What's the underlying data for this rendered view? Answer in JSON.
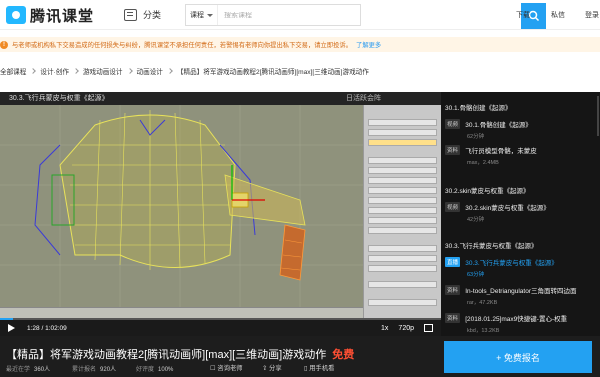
{
  "header": {
    "brand": "腾讯课堂",
    "category_label": "分类",
    "search_type": "课程",
    "search_placeholder": "搜索课程",
    "links": [
      "下载",
      "私信",
      "登录"
    ]
  },
  "notice": {
    "text": "与老师或机构私下交易造成的任何损失与纠纷，腾讯课堂不承担任何责任，若警惕有老师向你提出私下交易，请立即投诉。",
    "link": "了解更多"
  },
  "breadcrumb": [
    "全部课程",
    "设计·创作",
    "游戏动画设计",
    "动画设计",
    "【精品】将军游戏动画教程2[腾讯动画师][max][三维动画]游戏动作"
  ],
  "player": {
    "title": "30.3.飞行兵蒙皮与权重《起源》",
    "app_title": "日活跃会阵",
    "time": "1:28 / 1:02:09",
    "quality": "720p",
    "speed": "1x",
    "progress": 0.03
  },
  "playlist": {
    "sections": [
      "30.1.骨骼创建《起源》",
      "30.2.skin蒙皮与权重《起源》",
      "30.3.飞行兵蒙皮与权重《起源》"
    ],
    "items": [
      {
        "tag": "视频",
        "title": "30.1.骨骼创建《起源》",
        "sub": "62分钟"
      },
      {
        "tag": "资料",
        "title": "飞行员模型骨骼，未蒙皮",
        "sub": "max，2.4MB"
      },
      {
        "tag": "视频",
        "title": "30.2.skin蒙皮与权重《起源》",
        "sub": "42分钟"
      },
      {
        "tag": "直播",
        "title": "30.3.飞行兵蒙皮与权重《起源》",
        "sub": "63分钟"
      },
      {
        "tag": "资料",
        "title": "In-tools_Detriangulator三角面转四边面",
        "sub": "rar，47.2KB"
      },
      {
        "tag": "资料",
        "title": "[2018.01.25]max9快捷键-置心-权重",
        "sub": "kbd，13.2KB"
      }
    ]
  },
  "course": {
    "title": "【精品】将军游戏动画教程2[腾讯动画师][max][三维动画]游戏动作",
    "price": "免费",
    "recent_label": "最近在学",
    "recent_value": "360人",
    "total_label": "累计报名",
    "total_value": "920人",
    "rating_label": "好评度",
    "rating_value": "100%",
    "consult_label": "咨询老师",
    "share_label": "分享",
    "mobile_label": "用手机看",
    "enroll_label": "+ 免费报名"
  },
  "colors": {
    "brand": "#23a1f2",
    "price": "#ff4f33",
    "notice_text": "#d26a16",
    "notice_bg": "#fff5e6"
  }
}
